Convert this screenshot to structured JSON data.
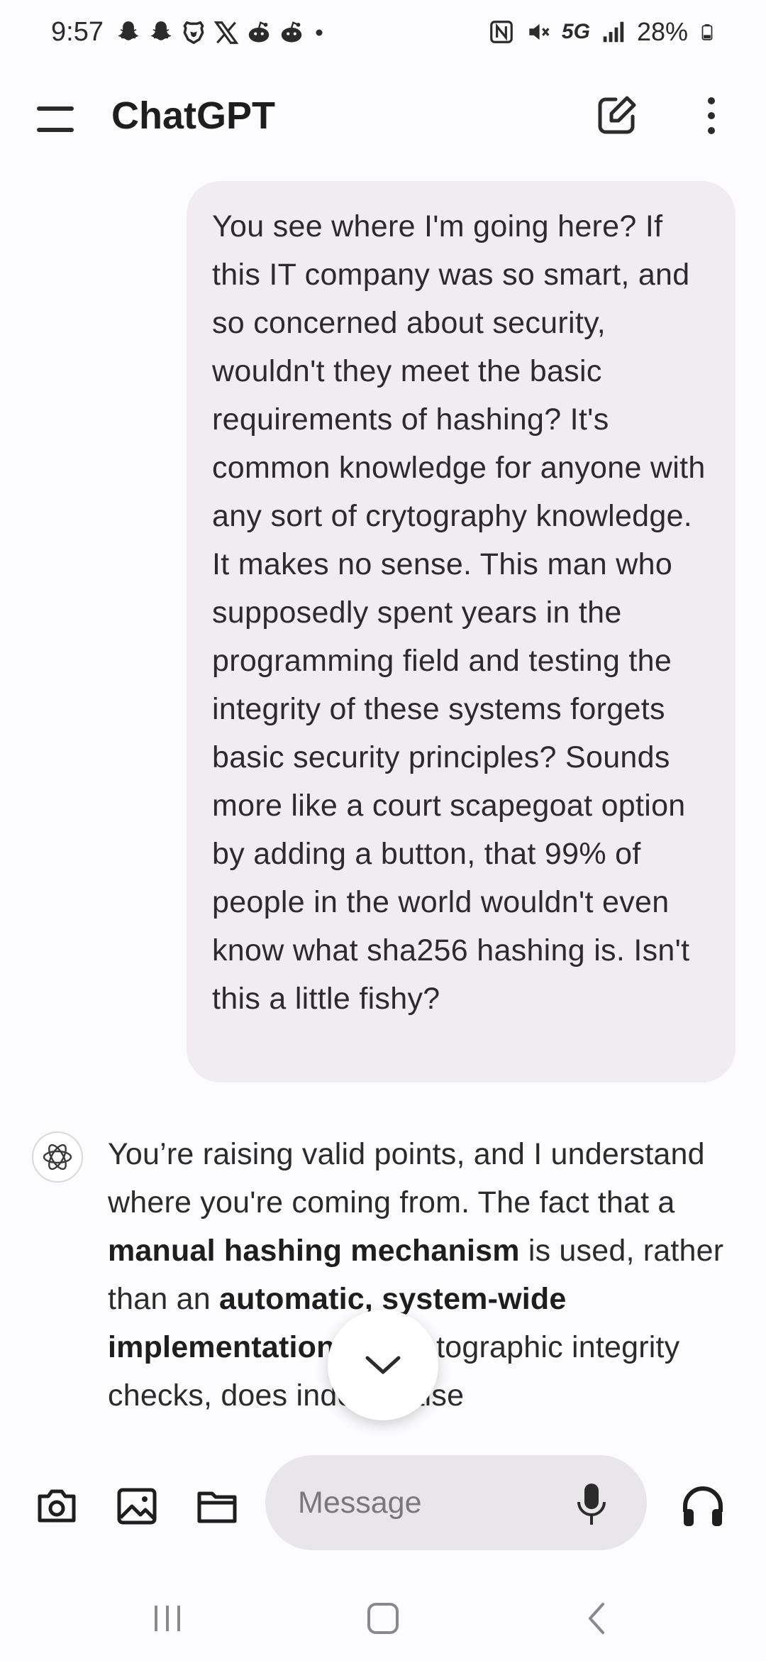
{
  "status_bar": {
    "time": "9:57",
    "battery": "28%",
    "network": "5G",
    "icons": [
      "snapchat-icon",
      "snapchat-icon",
      "brave-icon",
      "x-icon",
      "reddit-icon",
      "reddit-icon",
      "dot-icon",
      "nfc-icon",
      "mute-icon",
      "signal-icon",
      "battery-icon"
    ]
  },
  "app_bar": {
    "title": "ChatGPT",
    "icons": [
      "menu-icon",
      "new-chat-icon",
      "more-vert-icon"
    ]
  },
  "chat": {
    "user_message": "You see where I'm going here? If this IT company was so smart, and so concerned about security, wouldn't they meet the basic requirements of hashing? It's common knowledge for anyone with any sort of crytography knowledge. It makes no sense. This man who supposedly spent years in the programming field and testing the integrity of these systems forgets basic security principles? Sounds more like a court scapegoat option by adding a button, that 99% of people in the world wouldn't even know what sha256 hashing is. Isn't this a little fishy?",
    "assistant_message": {
      "t1": "You’re raising valid points, and I understand where you're coming from. The fact that a ",
      "b1": "manual hashing mechanism",
      "t2": " is used, rather than an ",
      "b2": "automatic, system-wide implementation",
      "t3": " of cryptographic integrity checks, does indeed raise"
    }
  },
  "composer": {
    "placeholder": "Message",
    "icons": [
      "camera-icon",
      "image-icon",
      "folder-icon",
      "mic-icon",
      "headphones-icon"
    ]
  },
  "nav_bar": {
    "icons": [
      "recents-icon",
      "home-icon",
      "back-icon"
    ]
  },
  "colors": {
    "background": "#fcfbfd",
    "user_bubble": "#f0ecf2",
    "input_field": "#e8e6e9",
    "text": "#2b2b2b"
  }
}
